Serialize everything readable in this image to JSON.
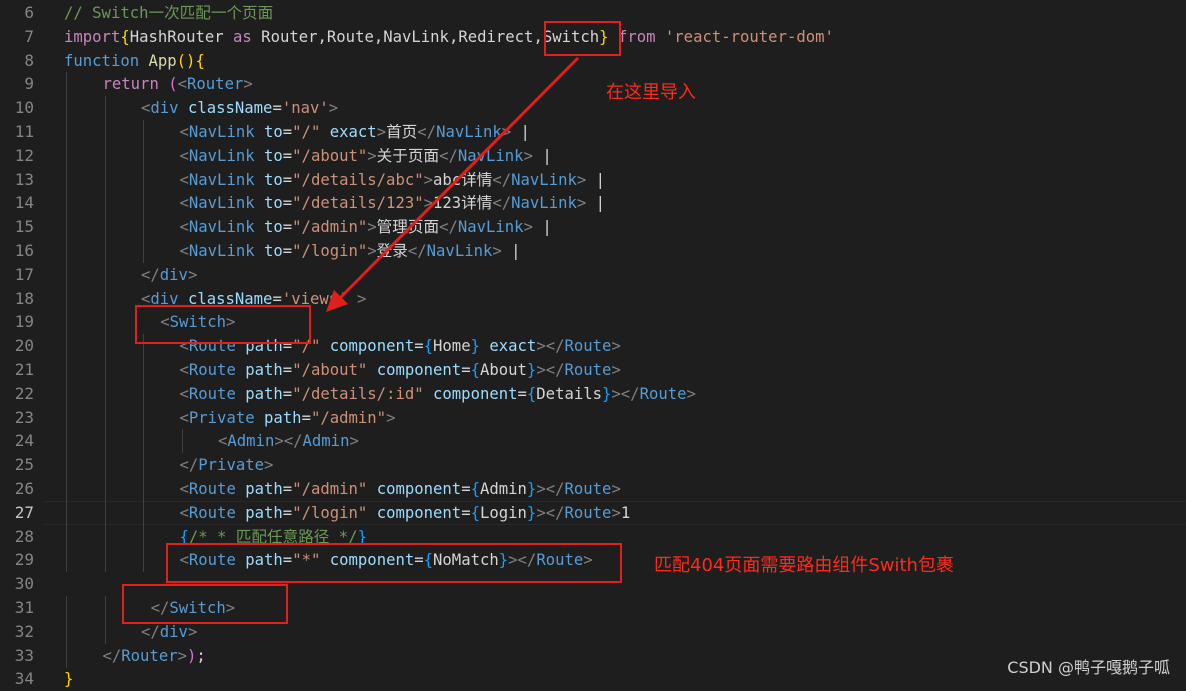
{
  "editor": {
    "active_line": 27,
    "lines": [
      {
        "num": 6,
        "indent": 0,
        "tokens": [
          [
            "// Switch一次匹配一个页面",
            "cm"
          ]
        ]
      },
      {
        "num": 7,
        "indent": 0,
        "tokens": [
          [
            "import",
            "ctl"
          ],
          [
            "{",
            "br"
          ],
          [
            "HashRouter ",
            "txt"
          ],
          [
            "as",
            "ctl"
          ],
          [
            " Router,Route,NavLink,Redirect,Switch",
            "txt"
          ],
          [
            "}",
            "br"
          ],
          [
            " ",
            "txt"
          ],
          [
            "from",
            "ctl"
          ],
          [
            " ",
            "txt"
          ],
          [
            "'react-router-dom'",
            "str"
          ]
        ]
      },
      {
        "num": 8,
        "indent": 0,
        "tokens": [
          [
            "function",
            "kw"
          ],
          [
            " ",
            "txt"
          ],
          [
            "App",
            "fn"
          ],
          [
            "()",
            "br"
          ],
          [
            "{",
            "br"
          ]
        ]
      },
      {
        "num": 9,
        "indent": 1,
        "tokens": [
          [
            "return",
            "ctl"
          ],
          [
            " ",
            "txt"
          ],
          [
            "(",
            "br2"
          ],
          [
            "<",
            "pun"
          ],
          [
            "Router",
            "tag"
          ],
          [
            ">",
            "pun"
          ]
        ]
      },
      {
        "num": 10,
        "indent": 2,
        "tokens": [
          [
            "<",
            "pun"
          ],
          [
            "div",
            "tag"
          ],
          [
            " ",
            "txt"
          ],
          [
            "className",
            "attr"
          ],
          [
            "=",
            "txt"
          ],
          [
            "'nav'",
            "str"
          ],
          [
            ">",
            "pun"
          ]
        ]
      },
      {
        "num": 11,
        "indent": 3,
        "tokens": [
          [
            "<",
            "pun"
          ],
          [
            "NavLink",
            "tag"
          ],
          [
            " ",
            "txt"
          ],
          [
            "to",
            "attr"
          ],
          [
            "=",
            "txt"
          ],
          [
            "\"/\"",
            "str"
          ],
          [
            " ",
            "txt"
          ],
          [
            "exact",
            "attr"
          ],
          [
            ">",
            "pun"
          ],
          [
            "首页",
            "txt"
          ],
          [
            "</",
            "pun"
          ],
          [
            "NavLink",
            "tag"
          ],
          [
            ">",
            "pun"
          ],
          [
            " |",
            "txt"
          ]
        ]
      },
      {
        "num": 12,
        "indent": 3,
        "tokens": [
          [
            "<",
            "pun"
          ],
          [
            "NavLink",
            "tag"
          ],
          [
            " ",
            "txt"
          ],
          [
            "to",
            "attr"
          ],
          [
            "=",
            "txt"
          ],
          [
            "\"/about\"",
            "str"
          ],
          [
            ">",
            "pun"
          ],
          [
            "关于页面",
            "txt"
          ],
          [
            "</",
            "pun"
          ],
          [
            "NavLink",
            "tag"
          ],
          [
            ">",
            "pun"
          ],
          [
            " |",
            "txt"
          ]
        ]
      },
      {
        "num": 13,
        "indent": 3,
        "tokens": [
          [
            "<",
            "pun"
          ],
          [
            "NavLink",
            "tag"
          ],
          [
            " ",
            "txt"
          ],
          [
            "to",
            "attr"
          ],
          [
            "=",
            "txt"
          ],
          [
            "\"/details/abc\"",
            "str"
          ],
          [
            ">",
            "pun"
          ],
          [
            "abc详情",
            "txt"
          ],
          [
            "</",
            "pun"
          ],
          [
            "NavLink",
            "tag"
          ],
          [
            ">",
            "pun"
          ],
          [
            " |",
            "txt"
          ]
        ]
      },
      {
        "num": 14,
        "indent": 3,
        "tokens": [
          [
            "<",
            "pun"
          ],
          [
            "NavLink",
            "tag"
          ],
          [
            " ",
            "txt"
          ],
          [
            "to",
            "attr"
          ],
          [
            "=",
            "txt"
          ],
          [
            "\"/details/123\"",
            "str"
          ],
          [
            ">",
            "pun"
          ],
          [
            "123详情",
            "txt"
          ],
          [
            "</",
            "pun"
          ],
          [
            "NavLink",
            "tag"
          ],
          [
            ">",
            "pun"
          ],
          [
            " |",
            "txt"
          ]
        ]
      },
      {
        "num": 15,
        "indent": 3,
        "tokens": [
          [
            "<",
            "pun"
          ],
          [
            "NavLink",
            "tag"
          ],
          [
            " ",
            "txt"
          ],
          [
            "to",
            "attr"
          ],
          [
            "=",
            "txt"
          ],
          [
            "\"/admin\"",
            "str"
          ],
          [
            ">",
            "pun"
          ],
          [
            "管理页面",
            "txt"
          ],
          [
            "</",
            "pun"
          ],
          [
            "NavLink",
            "tag"
          ],
          [
            ">",
            "pun"
          ],
          [
            " |",
            "txt"
          ]
        ]
      },
      {
        "num": 16,
        "indent": 3,
        "tokens": [
          [
            "<",
            "pun"
          ],
          [
            "NavLink",
            "tag"
          ],
          [
            " ",
            "txt"
          ],
          [
            "to",
            "attr"
          ],
          [
            "=",
            "txt"
          ],
          [
            "\"/login\"",
            "str"
          ],
          [
            ">",
            "pun"
          ],
          [
            "登录",
            "txt"
          ],
          [
            "</",
            "pun"
          ],
          [
            "NavLink",
            "tag"
          ],
          [
            ">",
            "pun"
          ],
          [
            " |",
            "txt"
          ]
        ]
      },
      {
        "num": 17,
        "indent": 2,
        "tokens": [
          [
            "</",
            "pun"
          ],
          [
            "div",
            "tag"
          ],
          [
            ">",
            "pun"
          ]
        ]
      },
      {
        "num": 18,
        "indent": 2,
        "tokens": [
          [
            "<",
            "pun"
          ],
          [
            "div",
            "tag"
          ],
          [
            " ",
            "txt"
          ],
          [
            "className",
            "attr"
          ],
          [
            "=",
            "txt"
          ],
          [
            "'views'",
            "str"
          ],
          [
            " >",
            "pun"
          ]
        ]
      },
      {
        "num": 19,
        "indent": 2.5,
        "tokens": [
          [
            "<",
            "pun"
          ],
          [
            "Switch",
            "tag"
          ],
          [
            ">",
            "pun"
          ]
        ]
      },
      {
        "num": 20,
        "indent": 3,
        "tokens": [
          [
            "<",
            "pun"
          ],
          [
            "Route",
            "tag"
          ],
          [
            " ",
            "txt"
          ],
          [
            "path",
            "attr"
          ],
          [
            "=",
            "txt"
          ],
          [
            "\"/\"",
            "str"
          ],
          [
            " ",
            "txt"
          ],
          [
            "component",
            "attr"
          ],
          [
            "=",
            "txt"
          ],
          [
            "{",
            "br3"
          ],
          [
            "Home",
            "txt"
          ],
          [
            "}",
            "br3"
          ],
          [
            " ",
            "txt"
          ],
          [
            "exact",
            "attr"
          ],
          [
            "></",
            "pun"
          ],
          [
            "Route",
            "tag"
          ],
          [
            ">",
            "pun"
          ]
        ]
      },
      {
        "num": 21,
        "indent": 3,
        "tokens": [
          [
            "<",
            "pun"
          ],
          [
            "Route",
            "tag"
          ],
          [
            " ",
            "txt"
          ],
          [
            "path",
            "attr"
          ],
          [
            "=",
            "txt"
          ],
          [
            "\"/about\"",
            "str"
          ],
          [
            " ",
            "txt"
          ],
          [
            "component",
            "attr"
          ],
          [
            "=",
            "txt"
          ],
          [
            "{",
            "br3"
          ],
          [
            "About",
            "txt"
          ],
          [
            "}",
            "br3"
          ],
          [
            "></",
            "pun"
          ],
          [
            "Route",
            "tag"
          ],
          [
            ">",
            "pun"
          ]
        ]
      },
      {
        "num": 22,
        "indent": 3,
        "tokens": [
          [
            "<",
            "pun"
          ],
          [
            "Route",
            "tag"
          ],
          [
            " ",
            "txt"
          ],
          [
            "path",
            "attr"
          ],
          [
            "=",
            "txt"
          ],
          [
            "\"/details/:id\"",
            "str"
          ],
          [
            " ",
            "txt"
          ],
          [
            "component",
            "attr"
          ],
          [
            "=",
            "txt"
          ],
          [
            "{",
            "br3"
          ],
          [
            "Details",
            "txt"
          ],
          [
            "}",
            "br3"
          ],
          [
            "></",
            "pun"
          ],
          [
            "Route",
            "tag"
          ],
          [
            ">",
            "pun"
          ]
        ]
      },
      {
        "num": 23,
        "indent": 3,
        "tokens": [
          [
            "<",
            "pun"
          ],
          [
            "Private",
            "tag"
          ],
          [
            " ",
            "txt"
          ],
          [
            "path",
            "attr"
          ],
          [
            "=",
            "txt"
          ],
          [
            "\"/admin\"",
            "str"
          ],
          [
            ">",
            "pun"
          ]
        ]
      },
      {
        "num": 24,
        "indent": 4,
        "tokens": [
          [
            "<",
            "pun"
          ],
          [
            "Admin",
            "tag"
          ],
          [
            "></",
            "pun"
          ],
          [
            "Admin",
            "tag"
          ],
          [
            ">",
            "pun"
          ]
        ]
      },
      {
        "num": 25,
        "indent": 3,
        "tokens": [
          [
            "</",
            "pun"
          ],
          [
            "Private",
            "tag"
          ],
          [
            ">",
            "pun"
          ]
        ]
      },
      {
        "num": 26,
        "indent": 3,
        "tokens": [
          [
            "<",
            "pun"
          ],
          [
            "Route",
            "tag"
          ],
          [
            " ",
            "txt"
          ],
          [
            "path",
            "attr"
          ],
          [
            "=",
            "txt"
          ],
          [
            "\"/admin\"",
            "str"
          ],
          [
            " ",
            "txt"
          ],
          [
            "component",
            "attr"
          ],
          [
            "=",
            "txt"
          ],
          [
            "{",
            "br3"
          ],
          [
            "Admin",
            "txt"
          ],
          [
            "}",
            "br3"
          ],
          [
            "></",
            "pun"
          ],
          [
            "Route",
            "tag"
          ],
          [
            ">",
            "pun"
          ]
        ]
      },
      {
        "num": 27,
        "indent": 3,
        "tokens": [
          [
            "<",
            "pun"
          ],
          [
            "Route",
            "tag"
          ],
          [
            " ",
            "txt"
          ],
          [
            "path",
            "attr"
          ],
          [
            "=",
            "txt"
          ],
          [
            "\"/login\"",
            "str"
          ],
          [
            " ",
            "txt"
          ],
          [
            "component",
            "attr"
          ],
          [
            "=",
            "txt"
          ],
          [
            "{",
            "br3"
          ],
          [
            "Login",
            "txt"
          ],
          [
            "}",
            "br3"
          ],
          [
            "></",
            "pun"
          ],
          [
            "Route",
            "tag"
          ],
          [
            ">",
            "pun"
          ],
          [
            "1",
            "txt"
          ]
        ]
      },
      {
        "num": 28,
        "indent": 3,
        "tokens": [
          [
            "{",
            "br3"
          ],
          [
            "/* * 匹配任意路径 */",
            "cm"
          ],
          [
            "}",
            "br3"
          ]
        ]
      },
      {
        "num": 29,
        "indent": 3,
        "tokens": [
          [
            "<",
            "pun"
          ],
          [
            "Route",
            "tag"
          ],
          [
            " ",
            "txt"
          ],
          [
            "path",
            "attr"
          ],
          [
            "=",
            "txt"
          ],
          [
            "\"*\"",
            "str"
          ],
          [
            " ",
            "txt"
          ],
          [
            "component",
            "attr"
          ],
          [
            "=",
            "txt"
          ],
          [
            "{",
            "br3"
          ],
          [
            "NoMatch",
            "txt"
          ],
          [
            "}",
            "br3"
          ],
          [
            "></",
            "pun"
          ],
          [
            "Route",
            "tag"
          ],
          [
            ">",
            "pun"
          ]
        ]
      },
      {
        "num": 30,
        "indent": 0,
        "tokens": []
      },
      {
        "num": 31,
        "indent": 2.25,
        "tokens": [
          [
            "</",
            "pun"
          ],
          [
            "Switch",
            "tag"
          ],
          [
            ">",
            "pun"
          ]
        ]
      },
      {
        "num": 32,
        "indent": 2,
        "tokens": [
          [
            "</",
            "pun"
          ],
          [
            "div",
            "tag"
          ],
          [
            ">",
            "pun"
          ]
        ]
      },
      {
        "num": 33,
        "indent": 1,
        "tokens": [
          [
            "</",
            "pun"
          ],
          [
            "Router",
            "tag"
          ],
          [
            ">",
            "pun"
          ],
          [
            ")",
            "br2"
          ],
          [
            ";",
            "txt"
          ]
        ]
      },
      {
        "num": 34,
        "indent": 0,
        "tokens": [
          [
            "}",
            "br"
          ]
        ]
      }
    ]
  },
  "annotations": {
    "import_note": "在这里导入",
    "switch_note": "匹配404页面需要路由组件Swith包裹"
  },
  "watermark": "CSDN @鸭子嘎鹅子呱",
  "colors": {
    "annotation": "#e0201c",
    "background": "#1e1e1e"
  }
}
